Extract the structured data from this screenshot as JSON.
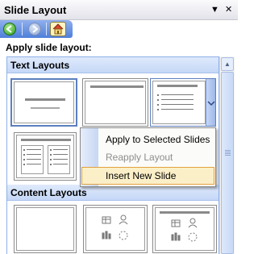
{
  "title_bar": {
    "title": "Slide Layout",
    "dropdown_glyph": "▼",
    "close_glyph": "✕"
  },
  "toolbar": {
    "buttons": [
      "back-icon",
      "forward-icon",
      "home-icon"
    ]
  },
  "apply_label": "Apply slide layout:",
  "sections": {
    "text_layouts": "Text Layouts",
    "content_layouts": "Content Layouts"
  },
  "context_menu": {
    "items": [
      {
        "label": "Apply to Selected Slides",
        "state": "enabled"
      },
      {
        "label": "Reapply Layout",
        "state": "disabled"
      },
      {
        "label": "Insert New Slide",
        "state": "highlighted"
      }
    ]
  },
  "colors": {
    "toolbar": "#4e7fd9",
    "section_header": "#c5d8f7",
    "menu_highlight": "#fbefc8",
    "menu_highlight_border": "#e2a23e"
  }
}
